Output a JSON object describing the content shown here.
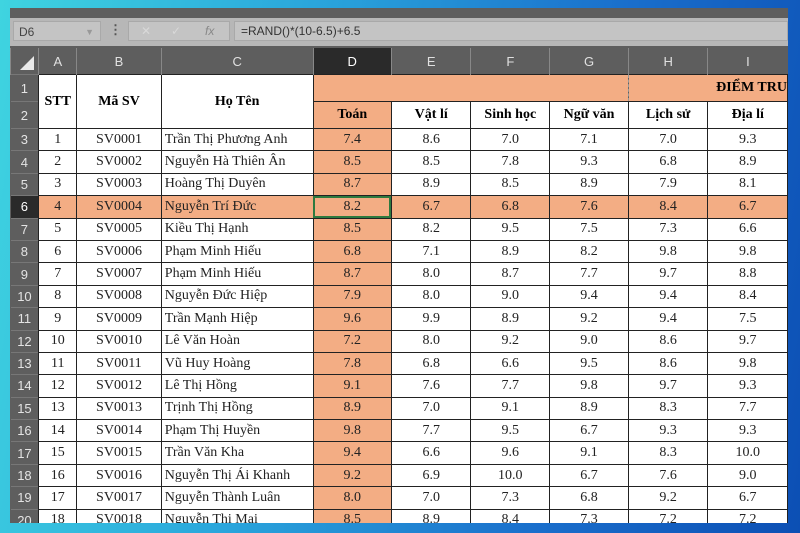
{
  "formula_bar": {
    "name_box": "D6",
    "more_icon": "⋮",
    "cancel_icon": "✕",
    "enter_icon": "✓",
    "fx_label": "fx",
    "formula": "=RAND()*(10-6.5)+6.5"
  },
  "columns": [
    "A",
    "B",
    "C",
    "D",
    "E",
    "F",
    "G",
    "H",
    "I"
  ],
  "selected_column": "D",
  "selected_row": 6,
  "header": {
    "stt": "STT",
    "ma_sv": "Mã SV",
    "ho_ten": "Họ Tên",
    "band_title": "ĐIỂM TRU",
    "subjects": [
      "Toán",
      "Vật lí",
      "Sinh học",
      "Ngữ văn",
      "Lịch sử",
      "Địa lí"
    ]
  },
  "row_numbers": [
    "1",
    "2"
  ],
  "rows": [
    {
      "r": "3",
      "stt": "1",
      "id": "SV0001",
      "name": "Trần Thị Phương Anh",
      "s": [
        "7.4",
        "8.6",
        "7.0",
        "7.1",
        "7.0",
        "9.3"
      ]
    },
    {
      "r": "4",
      "stt": "2",
      "id": "SV0002",
      "name": "Nguyễn Hà Thiên Ân",
      "s": [
        "8.5",
        "8.5",
        "7.8",
        "9.3",
        "6.8",
        "8.9"
      ]
    },
    {
      "r": "5",
      "stt": "3",
      "id": "SV0003",
      "name": "Hoàng Thị Duyên",
      "s": [
        "8.7",
        "8.9",
        "8.5",
        "8.9",
        "7.9",
        "8.1"
      ]
    },
    {
      "r": "6",
      "stt": "4",
      "id": "SV0004",
      "name": "Nguyễn Trí Đức",
      "s": [
        "8.2",
        "6.7",
        "6.8",
        "7.6",
        "8.4",
        "6.7"
      ]
    },
    {
      "r": "7",
      "stt": "5",
      "id": "SV0005",
      "name": "Kiều Thị Hạnh",
      "s": [
        "8.5",
        "8.2",
        "9.5",
        "7.5",
        "7.3",
        "6.6"
      ]
    },
    {
      "r": "8",
      "stt": "6",
      "id": "SV0006",
      "name": "Phạm Minh Hiếu",
      "s": [
        "6.8",
        "7.1",
        "8.9",
        "8.2",
        "9.8",
        "9.8"
      ]
    },
    {
      "r": "9",
      "stt": "7",
      "id": "SV0007",
      "name": "Phạm Minh Hiếu",
      "s": [
        "8.7",
        "8.0",
        "8.7",
        "7.7",
        "9.7",
        "8.8"
      ]
    },
    {
      "r": "10",
      "stt": "8",
      "id": "SV0008",
      "name": "Nguyễn Đức Hiệp",
      "s": [
        "7.9",
        "8.0",
        "9.0",
        "9.4",
        "9.4",
        "8.4"
      ]
    },
    {
      "r": "11",
      "stt": "9",
      "id": "SV0009",
      "name": "Trần Mạnh Hiệp",
      "s": [
        "9.6",
        "9.9",
        "8.9",
        "9.2",
        "9.4",
        "7.5"
      ]
    },
    {
      "r": "12",
      "stt": "10",
      "id": "SV0010",
      "name": "Lê Văn Hoàn",
      "s": [
        "7.2",
        "8.0",
        "9.2",
        "9.0",
        "8.6",
        "9.7"
      ]
    },
    {
      "r": "13",
      "stt": "11",
      "id": "SV0011",
      "name": "Vũ Huy Hoàng",
      "s": [
        "7.8",
        "6.8",
        "6.6",
        "9.5",
        "8.6",
        "9.8"
      ]
    },
    {
      "r": "14",
      "stt": "12",
      "id": "SV0012",
      "name": "Lê Thị Hồng",
      "s": [
        "9.1",
        "7.6",
        "7.7",
        "9.8",
        "9.7",
        "9.3"
      ]
    },
    {
      "r": "15",
      "stt": "13",
      "id": "SV0013",
      "name": "Trịnh Thị Hồng",
      "s": [
        "8.9",
        "7.0",
        "9.1",
        "8.9",
        "8.3",
        "7.7"
      ]
    },
    {
      "r": "16",
      "stt": "14",
      "id": "SV0014",
      "name": "Phạm Thị Huyền",
      "s": [
        "9.8",
        "7.7",
        "9.5",
        "6.7",
        "9.3",
        "9.3"
      ]
    },
    {
      "r": "17",
      "stt": "15",
      "id": "SV0015",
      "name": "Trần Văn Kha",
      "s": [
        "9.4",
        "6.6",
        "9.6",
        "9.1",
        "8.3",
        "10.0"
      ]
    },
    {
      "r": "18",
      "stt": "16",
      "id": "SV0016",
      "name": "Nguyễn Thị Ái Khanh",
      "s": [
        "9.2",
        "6.9",
        "10.0",
        "6.7",
        "7.6",
        "9.0"
      ]
    },
    {
      "r": "19",
      "stt": "17",
      "id": "SV0017",
      "name": "Nguyễn Thành Luân",
      "s": [
        "8.0",
        "7.0",
        "7.3",
        "6.8",
        "9.2",
        "6.7"
      ]
    },
    {
      "r": "20",
      "stt": "18",
      "id": "SV0018",
      "name": "Nguyễn Thị Mai",
      "s": [
        "8.5",
        "8.9",
        "8.4",
        "7.3",
        "7.2",
        "7.2"
      ]
    }
  ]
}
